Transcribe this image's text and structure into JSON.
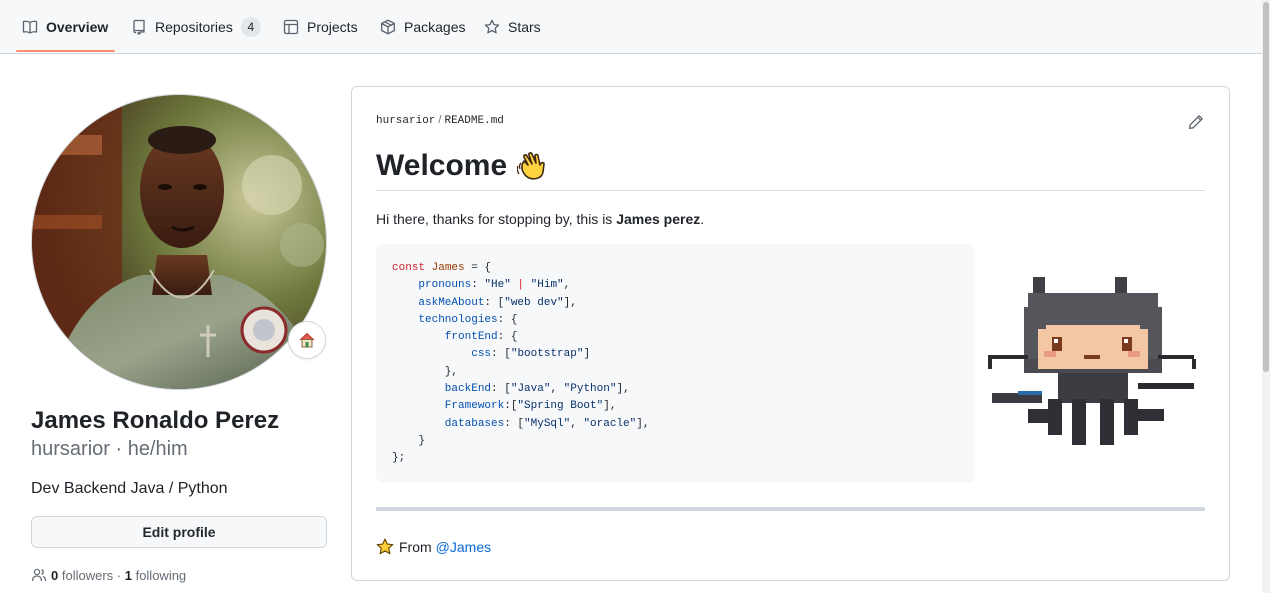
{
  "nav": {
    "tabs": [
      {
        "label": "Overview",
        "icon": "book-icon"
      },
      {
        "label": "Repositories",
        "icon": "repo-icon",
        "count": "4"
      },
      {
        "label": "Projects",
        "icon": "table-icon"
      },
      {
        "label": "Packages",
        "icon": "package-icon"
      },
      {
        "label": "Stars",
        "icon": "star-icon"
      }
    ],
    "active_tab": "Overview",
    "accent_color": "#fd8c73"
  },
  "profile": {
    "full_name": "James Ronaldo Perez",
    "username_line": "hursarior · he/him",
    "bio": "Dev Backend Java / Python",
    "edit_button": "Edit profile",
    "status_icon": "house-icon",
    "followers_count": "0",
    "followers_label": "followers",
    "separator": " · ",
    "following_count": "1",
    "following_label": "following"
  },
  "readme": {
    "owner": "hursarior",
    "file": "README.md",
    "crumb_sep": "/",
    "title": "Welcome",
    "title_emoji": "waving-hand-icon",
    "intro_text": "Hi there, thanks for stopping by, this is ",
    "intro_name": "James perez",
    "intro_end": ".",
    "code": {
      "l1_kw": "const",
      "l1_name": " James",
      "l1_rest": " = {",
      "l2_key": "    pronouns",
      "l2_rest_a": ": ",
      "l2_v1": "\"He\"",
      "l2_op": " | ",
      "l2_v2": "\"Him\"",
      "l2_end": ",",
      "l3_key": "    askMeAbout",
      "l3_a": ": [",
      "l3_v": "\"web dev\"",
      "l3_end": "],",
      "l4_key": "    technologies",
      "l4_end": ": {",
      "l5_key": "        frontEnd",
      "l5_end": ": {",
      "l6_key": "            css",
      "l6_a": ": [",
      "l6_v": "\"bootstrap\"",
      "l6_end": "]",
      "l7": "        },",
      "l8_key": "        backEnd",
      "l8_a": ": [",
      "l8_v1": "\"Java\"",
      "l8_c": ", ",
      "l8_v2": "\"Python\"",
      "l8_end": "],",
      "l9_key": "        Framework",
      "l9_a": ":[",
      "l9_v": "\"Spring Boot\"",
      "l9_end": "],",
      "l10_key": "        databases",
      "l10_a": ": [",
      "l10_v1": "\"MySql\"",
      "l10_c": ", ",
      "l10_v2": "\"oracle\"",
      "l10_end": "],",
      "l11": "    }",
      "l12": "};"
    },
    "illustration": "octocat-pixel-art",
    "from_label": "From",
    "from_link": "@James",
    "from_icon": "star-icon"
  }
}
